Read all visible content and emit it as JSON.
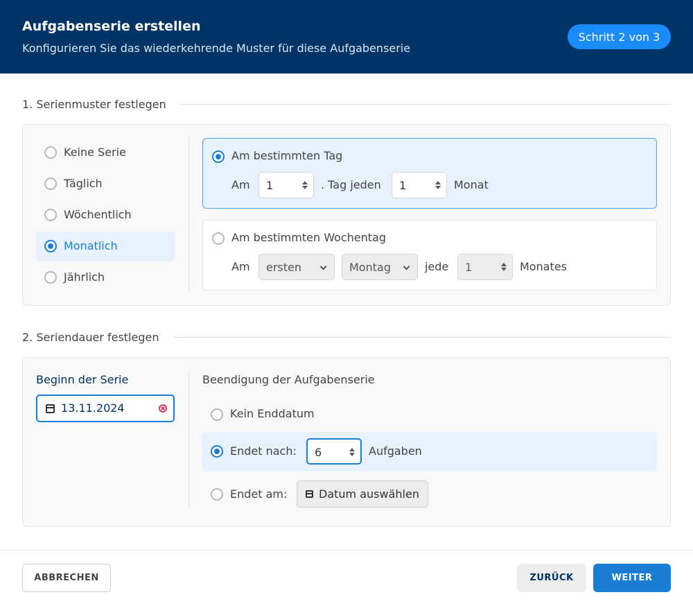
{
  "header": {
    "title": "Aufgabenserie erstellen",
    "subtitle": "Konfigurieren Sie das wiederkehrende Muster für diese Aufgabenserie",
    "step_badge": "Schritt 2 von 3"
  },
  "section1": {
    "title": "1. Serienmuster festlegen",
    "patterns": [
      {
        "label": "Keine Serie",
        "checked": false
      },
      {
        "label": "Täglich",
        "checked": false
      },
      {
        "label": "Wöchentlich",
        "checked": false
      },
      {
        "label": "Monatlich",
        "checked": true
      },
      {
        "label": "Jährlich",
        "checked": false
      }
    ],
    "option_day": {
      "label": "Am bestimmten Tag",
      "prefix": "Am",
      "day_value": "1",
      "middle": ". Tag jeden",
      "month_value": "1",
      "suffix": "Monat"
    },
    "option_weekday": {
      "label": "Am bestimmten Wochentag",
      "prefix": "Am",
      "ordinal_value": "ersten",
      "weekday_value": "Montag",
      "middle": "jede",
      "interval_value": "1",
      "suffix": "Monates"
    }
  },
  "section2": {
    "title": "2. Seriendauer festlegen",
    "start_label": "Beginn der Serie",
    "start_date": "13.11.2024",
    "end_label": "Beendigung der Aufgabenserie",
    "end_none": "Kein Enddatum",
    "end_after_label": "Endet nach:",
    "end_after_value": "6",
    "end_after_suffix": "Aufgaben",
    "end_on_label": "Endet am:",
    "end_on_button": "Datum auswählen"
  },
  "footer": {
    "cancel": "ABBRECHEN",
    "back": "ZURÜCK",
    "next": "WEITER"
  },
  "colors": {
    "header_bg": "#003366",
    "accent": "#1a7fd4",
    "badge": "#1a8cff",
    "clear_icon": "#d63a5a"
  }
}
